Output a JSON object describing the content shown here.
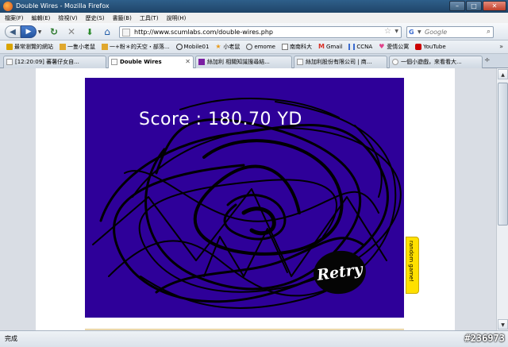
{
  "window": {
    "title": "Double Wires - Mozilla Firefox",
    "buttons": [
      "–",
      "□",
      "✕"
    ]
  },
  "menu": [
    "檔案(F)",
    "編輯(E)",
    "檢視(V)",
    "歷史(S)",
    "書籤(B)",
    "工具(T)",
    "說明(H)"
  ],
  "nav": {
    "url": "http://www.scumlabs.com/double-wires.php",
    "search_placeholder": "Google"
  },
  "bookmarks": [
    {
      "label": "最常瀏覽的網站",
      "icon": "star-folder-icon",
      "color": "#d9a400"
    },
    {
      "label": "一隻小老鼠",
      "icon": "folder-icon",
      "color": "#e0a82e"
    },
    {
      "label": "一+粉＊的天空・部落...",
      "icon": "folder-icon",
      "color": "#e0a82e"
    },
    {
      "label": "Mobile01",
      "icon": "mobile01-icon",
      "color": "#333333"
    },
    {
      "label": "小老鼠",
      "icon": "star-icon",
      "color": "#e89a1a"
    },
    {
      "label": "emome",
      "icon": "emome-icon",
      "color": "#555555"
    },
    {
      "label": "南南科大",
      "icon": "page-icon",
      "color": "#777777"
    },
    {
      "label": "Gmail",
      "icon": "gmail-icon",
      "color": "#d93025"
    },
    {
      "label": "CCNA",
      "icon": "chart-icon",
      "color": "#3b6bcf"
    },
    {
      "label": "愛情公寓",
      "icon": "heart-icon",
      "color": "#e0438a"
    },
    {
      "label": "YouTube",
      "icon": "youtube-icon",
      "color": "#cc0000"
    }
  ],
  "tabs": [
    {
      "label": "[12:20:09] 蕃薯仔女自...",
      "active": false
    },
    {
      "label": "Double Wires",
      "active": true
    },
    {
      "label": "絲加利 相關知識搜尋結...",
      "active": false
    },
    {
      "label": "絲加利股份有限公司 | 商...",
      "active": false
    },
    {
      "label": "一個小遊戲，來看看大...",
      "active": false
    }
  ],
  "game": {
    "score_text": "Score : 180.70 YD",
    "retry_label": "Retry",
    "side_tab_label": "random game!",
    "bg_color": "#2e0099"
  },
  "status": {
    "text": "完成",
    "watermark": "#236973"
  }
}
